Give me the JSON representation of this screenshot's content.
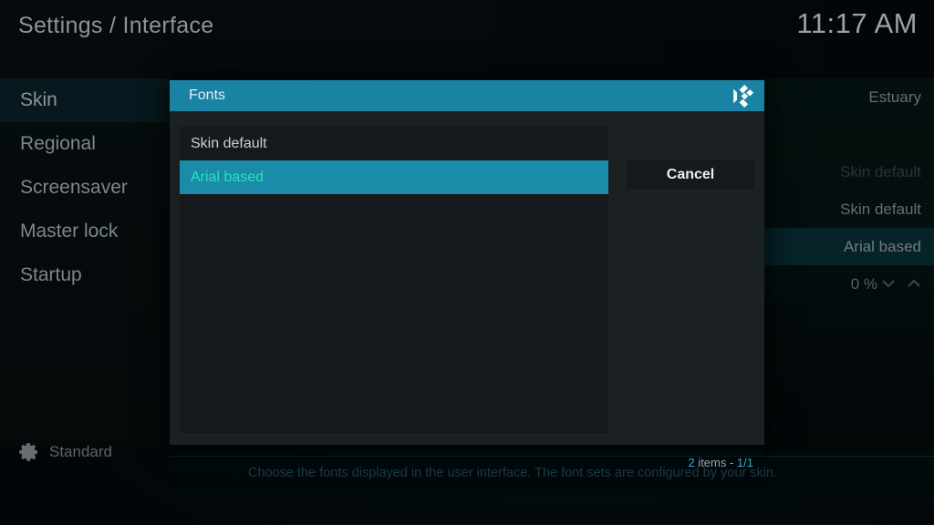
{
  "topbar": {
    "breadcrumb": "Settings / Interface",
    "clock": "11:17 AM"
  },
  "sidebar": {
    "items": [
      {
        "label": "Skin",
        "selected": true
      },
      {
        "label": "Regional",
        "selected": false
      },
      {
        "label": "Screensaver",
        "selected": false
      },
      {
        "label": "Master lock",
        "selected": false
      },
      {
        "label": "Startup",
        "selected": false
      }
    ]
  },
  "settings_panel": {
    "rows": [
      {
        "value": "Estuary",
        "state": "normal"
      },
      {
        "value": "",
        "state": "spacer"
      },
      {
        "value": "Skin default",
        "state": "dim"
      },
      {
        "value": "Skin default",
        "state": "normal"
      },
      {
        "value": "Arial based",
        "state": "highlighted"
      }
    ],
    "spinner_value": "0 %",
    "spinner_down_icon": "chevron-down-icon",
    "spinner_up_icon": "chevron-up-icon",
    "toggle_state": "off"
  },
  "dialog": {
    "title": "Fonts",
    "logo_icon": "kodi-logo-icon",
    "list_items": [
      {
        "label": "Skin default",
        "selected": false
      },
      {
        "label": "Arial based",
        "selected": true
      }
    ],
    "cancel_label": "Cancel",
    "item_count_prefix": "2",
    "item_count_middle": " items - ",
    "item_count_page": "1/1"
  },
  "description": "Choose the fonts displayed in the user interface. The font sets are configured by your skin.",
  "profile": {
    "icon": "gear-icon",
    "label": "Standard"
  },
  "colors": {
    "accent": "#1a83a4",
    "selected_text": "#2ce0c0",
    "count_number": "#35a8cf",
    "sidebar_selected_bg": "#07191e"
  }
}
